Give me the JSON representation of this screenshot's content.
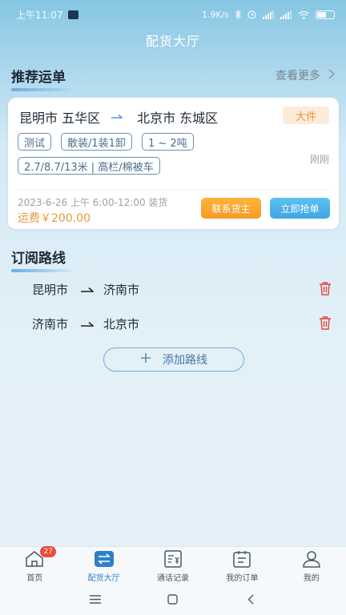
{
  "status_bar": {
    "time": "上午11:07",
    "net_speed": "1.9K/s",
    "battery_level": 0.6
  },
  "page": {
    "title": "配货大厅"
  },
  "recommended": {
    "section_title": "推荐运单",
    "more_label": "查看更多"
  },
  "order_card": {
    "origin": "昆明市 五华区",
    "destination": "北京市 东城区",
    "cargo_size_badge": "大件",
    "tags_row1": [
      "测试",
      "散装/1装1卸",
      "1 ~ 2吨"
    ],
    "tags_row2": [
      "2.7/8.7/13米 | 高栏/棉被车"
    ],
    "time_ago": "刚刚",
    "pickup_time": "2023-6-26 上午 6:00-12:00 装货",
    "freight": "运费￥200.00",
    "contact_button": "联系货主",
    "grab_button": "立即抢单"
  },
  "subscriptions": {
    "section_title": "订阅路线",
    "routes": [
      {
        "from": "昆明市",
        "to": "济南市"
      },
      {
        "from": "济南市",
        "to": "北京市"
      }
    ],
    "add_label": "添加路线"
  },
  "tab_bar": {
    "items": [
      {
        "label": "首页",
        "icon": "home-icon",
        "badge": "27"
      },
      {
        "label": "配货大厅",
        "icon": "dispatch-hall-icon",
        "active": true
      },
      {
        "label": "通话记录",
        "icon": "call-log-icon"
      },
      {
        "label": "我的订单",
        "icon": "orders-icon"
      },
      {
        "label": "我的",
        "icon": "profile-icon"
      }
    ]
  },
  "colors": {
    "accent": "#2f7fc8",
    "orange": "#f79b25",
    "blue_button": "#3fa6e6",
    "danger": "#e2453b"
  }
}
